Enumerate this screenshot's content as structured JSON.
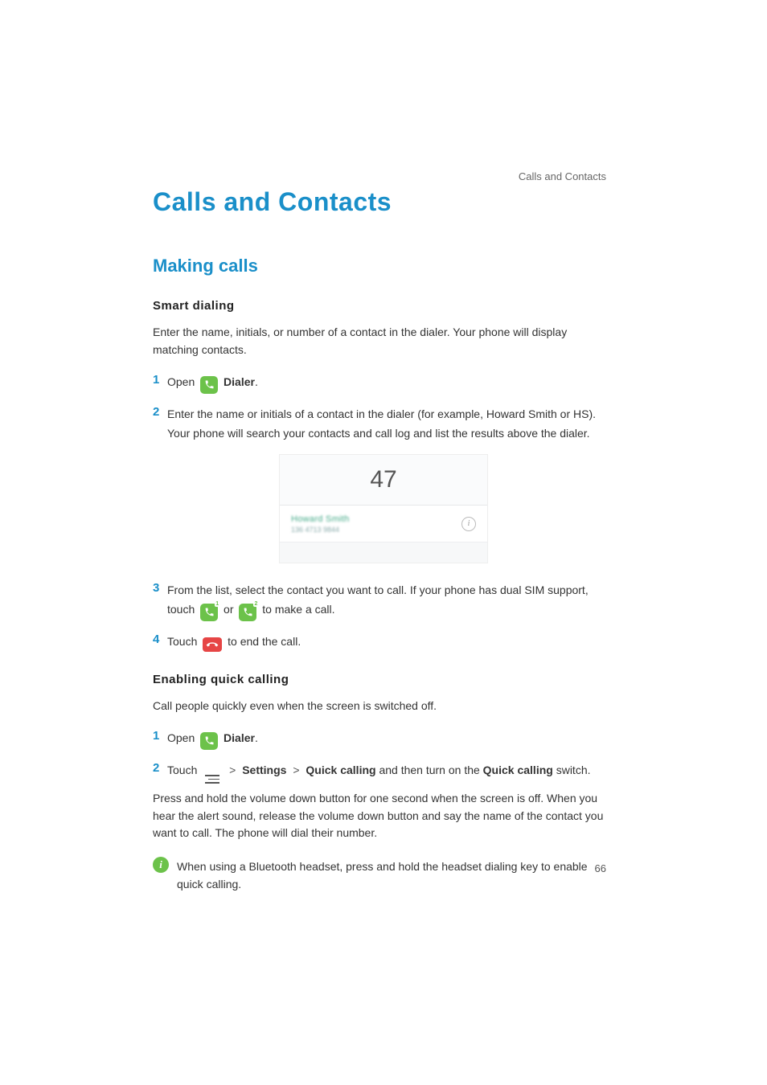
{
  "header_path": "Calls and Contacts",
  "title": "Calls and Contacts",
  "section1": {
    "title": "Making calls"
  },
  "smart_dialing": {
    "heading": "Smart dialing",
    "intro": "Enter the name, initials, or number of a contact in the dialer. Your phone will display matching contacts.",
    "step1_open": "Open ",
    "step1_dialer": "Dialer",
    "step1_period": ".",
    "step2": "Enter the name or initials of a contact in the dialer (for example, Howard Smith or HS). Your phone will search your contacts and call log and list the results above the dialer.",
    "step3_a": "From the list, select the contact you want to call. If your phone has dual SIM support, touch ",
    "step3_or": " or ",
    "step3_b": " to make a call.",
    "step4_a": "Touch ",
    "step4_b": " to end the call."
  },
  "screenshot": {
    "typed": "47",
    "contact_name": "Howard Smith",
    "contact_number": "136 4713 9844",
    "info_glyph": "i"
  },
  "quick_calling": {
    "heading": "Enabling quick calling",
    "intro": "Call people quickly even when the screen is switched off.",
    "step1_open": "Open ",
    "step1_dialer": "Dialer",
    "step1_period": ".",
    "step2_a": "Touch ",
    "step2_gt1": ">",
    "step2_settings": "Settings",
    "step2_gt2": ">",
    "step2_qc": "Quick calling",
    "step2_b": " and then turn on the ",
    "step2_qc2": "Quick calling",
    "step2_c": " switch.",
    "para": "Press and hold the volume down button for one second when the screen is off. When you hear the alert sound, release the volume down button and say the name of the contact you want to call. The phone will dial their number.",
    "note_glyph": "i",
    "note": "When using a Bluetooth headset, press and hold the headset dialing key to enable quick calling."
  },
  "step_numbers": {
    "n1": "1",
    "n2": "2",
    "n3": "3",
    "n4": "4"
  },
  "sim": {
    "one": "1",
    "two": "2"
  },
  "page_number": "66"
}
